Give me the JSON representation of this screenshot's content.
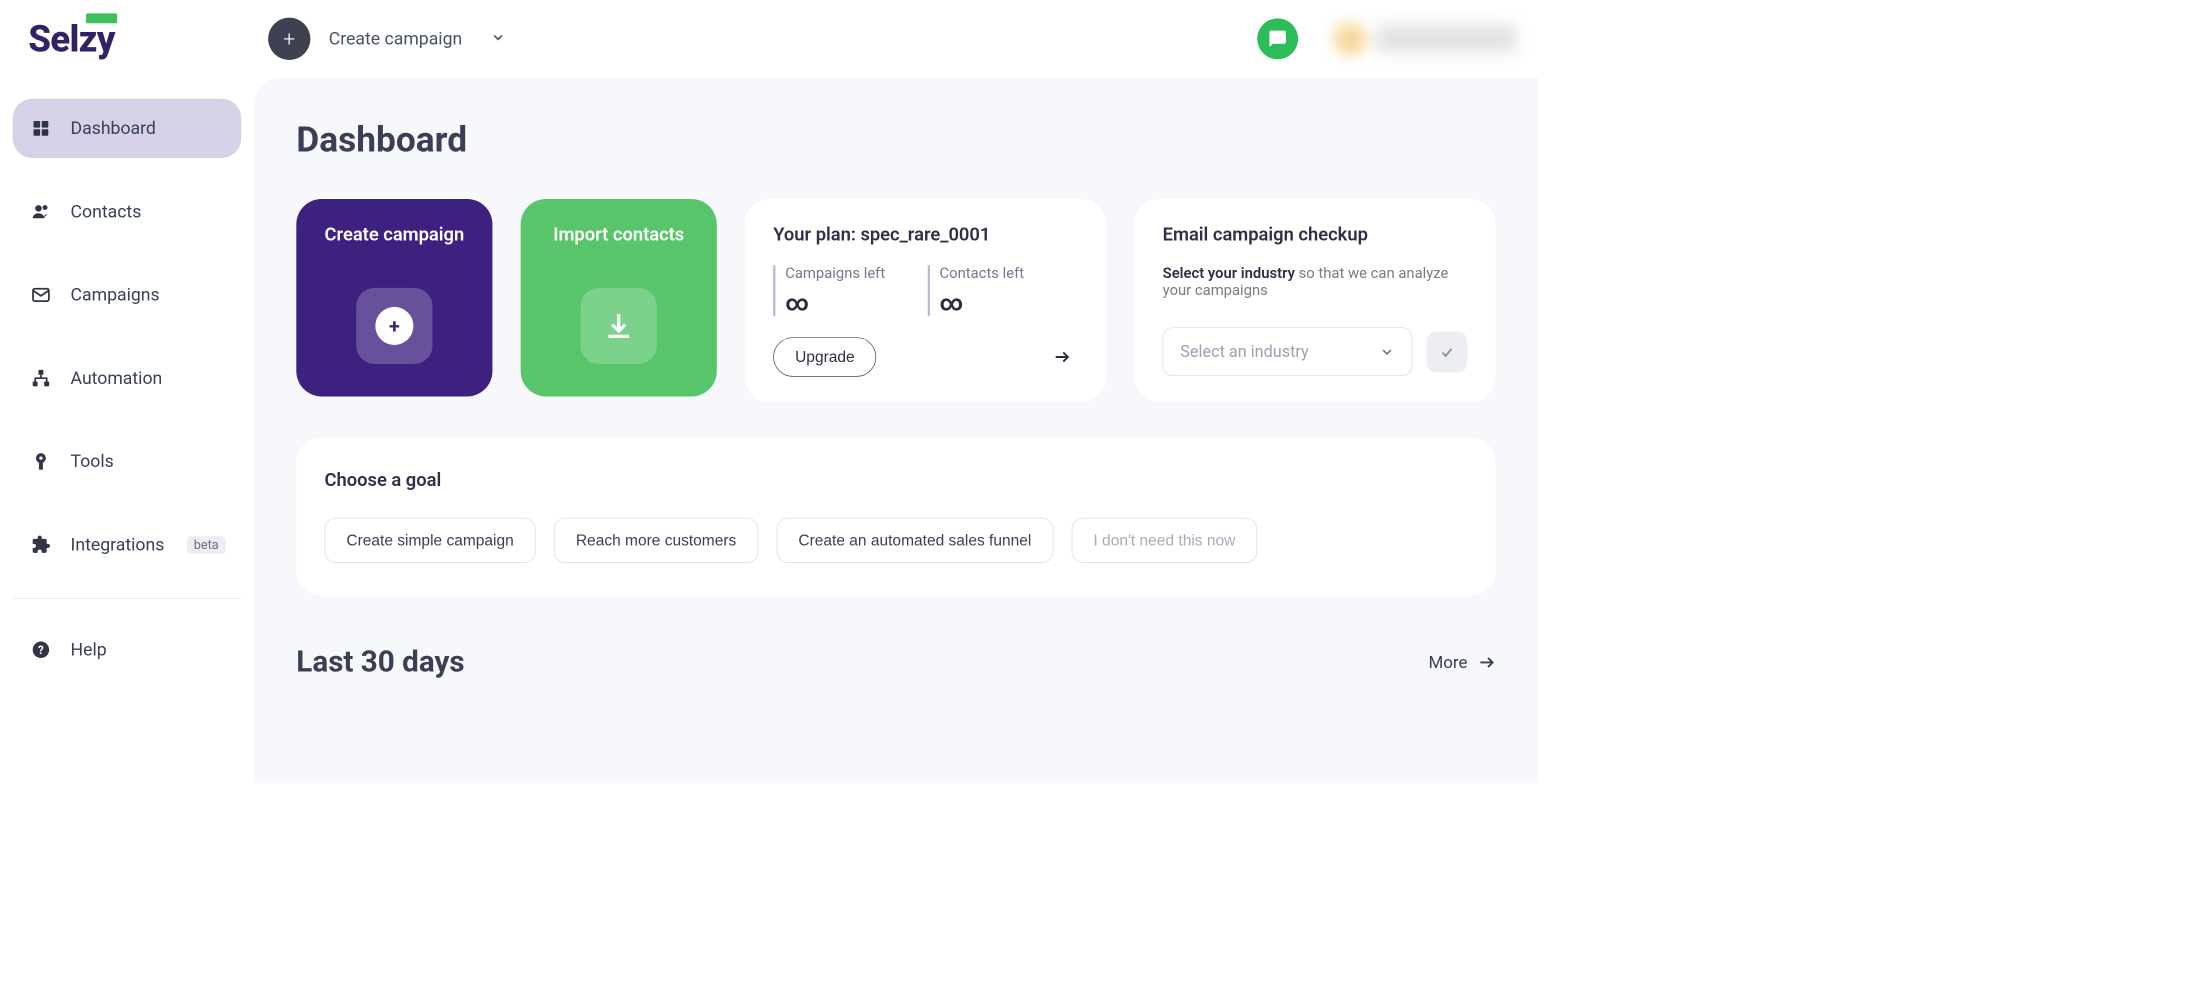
{
  "brand": "Selzy",
  "header": {
    "create_label": "Create campaign"
  },
  "sidebar": {
    "items": [
      {
        "label": "Dashboard"
      },
      {
        "label": "Contacts"
      },
      {
        "label": "Campaigns"
      },
      {
        "label": "Automation"
      },
      {
        "label": "Tools"
      },
      {
        "label": "Integrations",
        "badge": "beta"
      }
    ],
    "help": "Help"
  },
  "page": {
    "title": "Dashboard"
  },
  "tiles": {
    "create": "Create campaign",
    "import": "Import contacts"
  },
  "plan": {
    "title": "Your plan: spec_rare_0001",
    "stats": [
      {
        "label": "Campaigns left",
        "value": "∞"
      },
      {
        "label": "Contacts left",
        "value": "∞"
      }
    ],
    "upgrade": "Upgrade"
  },
  "checkup": {
    "title": "Email campaign checkup",
    "desc_bold": "Select your industry",
    "desc_rest": " so that we can analyze your campaigns",
    "placeholder": "Select an industry"
  },
  "goal": {
    "title": "Choose a goal",
    "pills": [
      "Create simple campaign",
      "Reach more customers",
      "Create an automated sales funnel",
      "I don't need this now"
    ]
  },
  "last30": {
    "title": "Last 30 days",
    "more": "More"
  }
}
